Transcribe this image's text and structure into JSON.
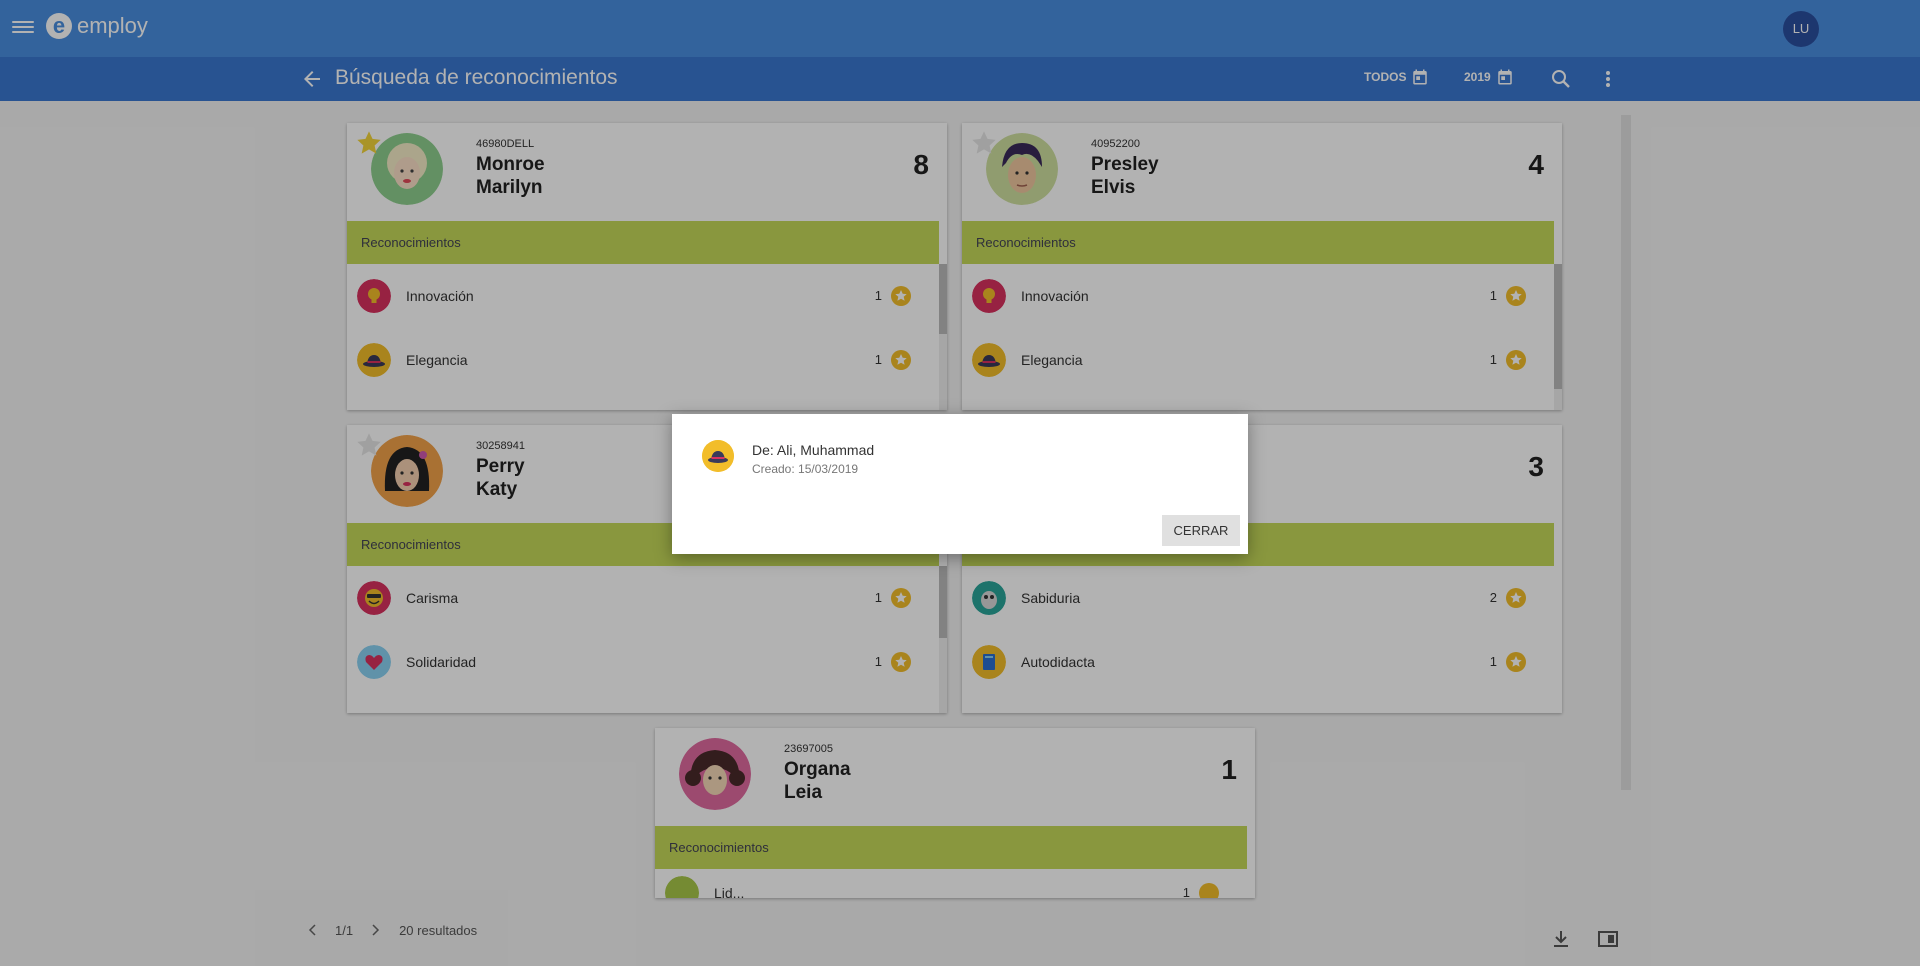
{
  "app": {
    "logo_text": "employ",
    "user_initials": "LU"
  },
  "toolbar": {
    "title": "Búsqueda de reconocimientos",
    "filter_all": "TODOS",
    "filter_year": "2019"
  },
  "cards": [
    {
      "id": "46980DELL",
      "last": "Monroe",
      "first": "Marilyn",
      "total": "8",
      "starred": true,
      "section": "Reconocimientos",
      "items": [
        {
          "name": "Innovación",
          "count": "1"
        },
        {
          "name": "Elegancia",
          "count": "1"
        }
      ]
    },
    {
      "id": "40952200",
      "last": "Presley",
      "first": "Elvis",
      "total": "4",
      "starred": false,
      "section": "Reconocimientos",
      "items": [
        {
          "name": "Innovación",
          "count": "1"
        },
        {
          "name": "Elegancia",
          "count": "1"
        }
      ]
    },
    {
      "id": "30258941",
      "last": "Perry",
      "first": "Katy",
      "total": "",
      "starred": false,
      "section": "Reconocimientos",
      "items": [
        {
          "name": "Carisma",
          "count": "1"
        },
        {
          "name": "Solidaridad",
          "count": "1"
        }
      ]
    },
    {
      "id": "",
      "last": "",
      "first": "",
      "total": "3",
      "starred": false,
      "section": "",
      "items": [
        {
          "name": "Sabiduria",
          "count": "2"
        },
        {
          "name": "Autodidacta",
          "count": "1"
        }
      ]
    },
    {
      "id": "23697005",
      "last": "Organa",
      "first": "Leia",
      "total": "1",
      "starred": false,
      "section": "Reconocimientos",
      "items": [
        {
          "name": "Lid...",
          "count": "1"
        }
      ]
    }
  ],
  "footer": {
    "page": "1/1",
    "results": "20 resultados"
  },
  "dialog": {
    "from": "De: Ali, Muhammad",
    "created": "Creado: 15/03/2019",
    "close_label": "CERRAR"
  },
  "colors": {
    "primary": "#4a8fe0",
    "primary_dark": "#3a77d0",
    "section": "#c4d85a",
    "star": "#f2bd2a"
  },
  "icons": [
    "menu-icon",
    "back-arrow-icon",
    "calendar-icon",
    "search-icon",
    "more-vert-icon",
    "chevron-left-icon",
    "chevron-right-icon",
    "download-icon",
    "view-toggle-icon",
    "star-icon"
  ]
}
